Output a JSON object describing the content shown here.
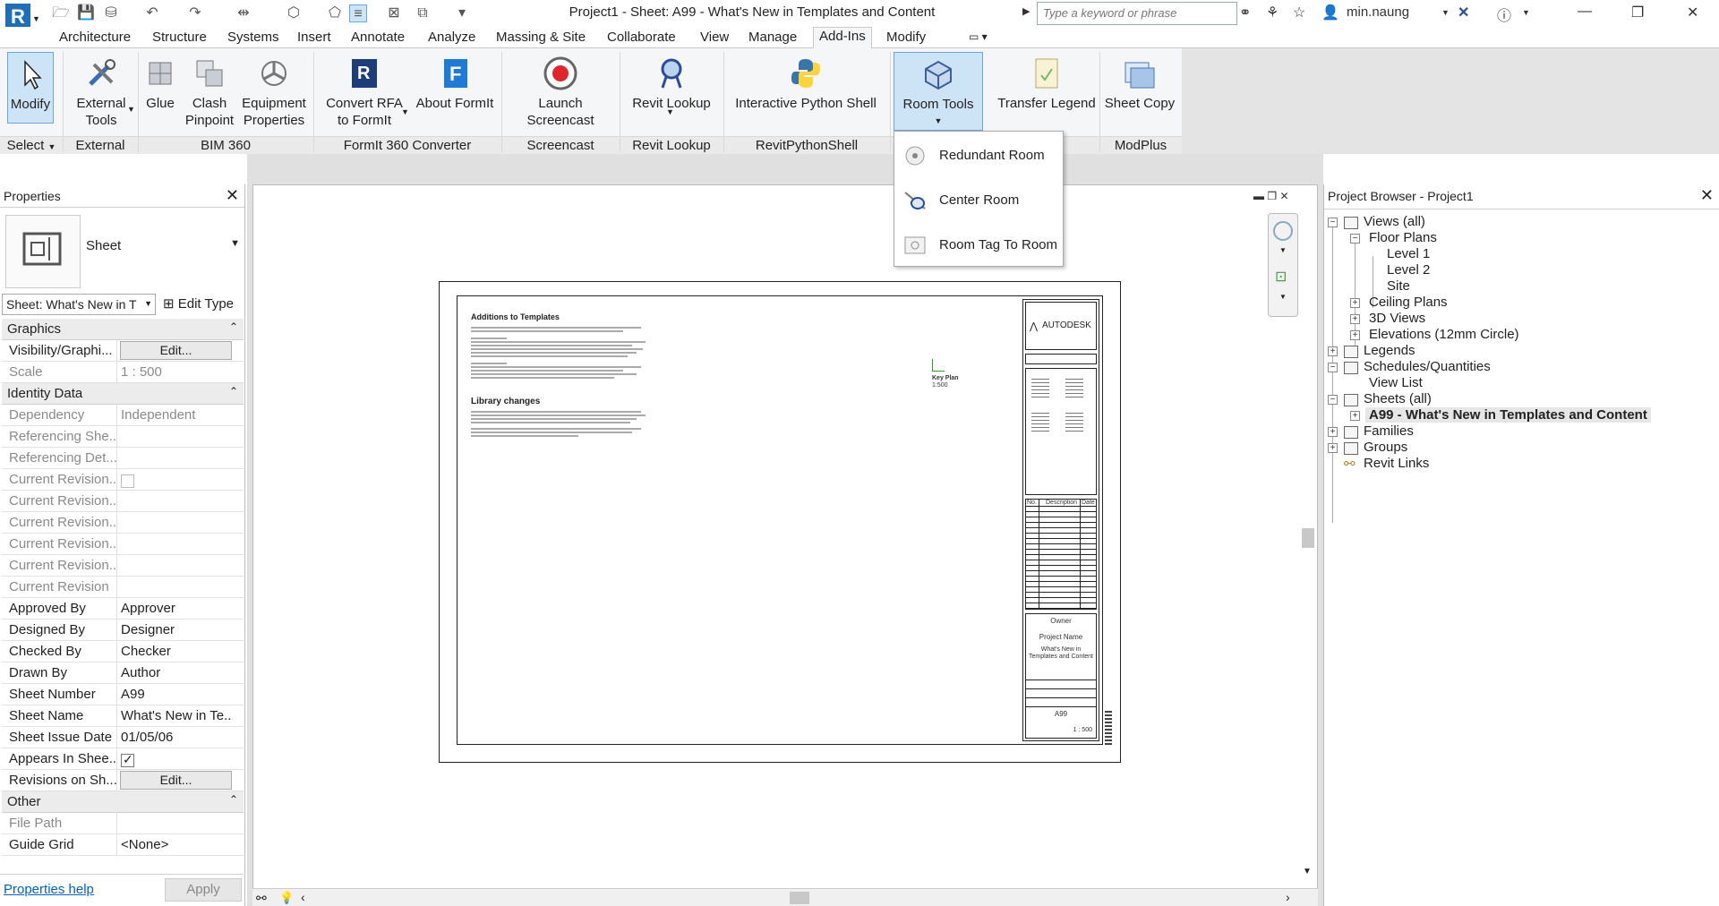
{
  "app": {
    "title": "Project1 - Sheet: A99 - What's New in Templates and Content",
    "search_placeholder": "Type a keyword or phrase",
    "user": "min.naung"
  },
  "tabs": [
    "Architecture",
    "Structure",
    "Systems",
    "Insert",
    "Annotate",
    "Analyze",
    "Massing & Site",
    "Collaborate",
    "View",
    "Manage",
    "Add-Ins",
    "Modify"
  ],
  "active_tab": "Add-Ins",
  "ribbon": {
    "buttons": {
      "modify": "Modify",
      "external_tools_1": "External",
      "external_tools_2": "Tools",
      "glue": "Glue",
      "clash_1": "Clash",
      "clash_2": "Pinpoint",
      "equip_1": "Equipment",
      "equip_2": "Properties",
      "convert_1": "Convert RFA",
      "convert_2": "to FormIt",
      "about_formit": "About FormIt",
      "screencast": "Launch Screencast",
      "revit_lookup": "Revit Lookup",
      "python_shell": "Interactive Python Shell",
      "room_tools": "Room Tools",
      "transfer_legend": "Transfer Legend",
      "sheet_copy": "Sheet Copy"
    },
    "groups": {
      "select": "Select",
      "external": "External",
      "bim360": "BIM 360",
      "formit": "FormIt 360 Converter",
      "screencast": "Screencast",
      "revit_lookup": "Revit Lookup",
      "python": "RevitPythonShell",
      "modplus": "ModPlus"
    }
  },
  "dropdown": {
    "items": [
      "Redundant Room",
      "Center Room",
      "Room Tag To Room"
    ]
  },
  "properties": {
    "title": "Properties",
    "type_name": "Sheet",
    "instance_selector": "Sheet: What's New in T",
    "edit_type": "Edit Type",
    "categories": {
      "graphics": "Graphics",
      "identity": "Identity Data",
      "other": "Other"
    },
    "graphics_rows": [
      {
        "k": "Visibility/Graphi...",
        "v": "Edit..."
      },
      {
        "k": "Scale",
        "v": "1 : 500"
      }
    ],
    "identity_rows": [
      {
        "k": "Dependency",
        "v": "Independent"
      },
      {
        "k": "Referencing She...",
        "v": ""
      },
      {
        "k": "Referencing Det...",
        "v": ""
      },
      {
        "k": "Current Revision...",
        "v": ""
      },
      {
        "k": "Current Revision...",
        "v": ""
      },
      {
        "k": "Current Revision...",
        "v": ""
      },
      {
        "k": "Current Revision...",
        "v": ""
      },
      {
        "k": "Current Revision...",
        "v": ""
      },
      {
        "k": "Current Revision",
        "v": ""
      },
      {
        "k": "Approved By",
        "v": "Approver"
      },
      {
        "k": "Designed By",
        "v": "Designer"
      },
      {
        "k": "Checked By",
        "v": "Checker"
      },
      {
        "k": "Drawn By",
        "v": "Author"
      },
      {
        "k": "Sheet Number",
        "v": "A99"
      },
      {
        "k": "Sheet Name",
        "v": "What's New in Te..."
      },
      {
        "k": "Sheet Issue Date",
        "v": "01/05/06"
      },
      {
        "k": "Appears In Shee...",
        "v": ""
      },
      {
        "k": "Revisions on Sh...",
        "v": "Edit..."
      }
    ],
    "other_rows": [
      {
        "k": "File Path",
        "v": ""
      },
      {
        "k": "Guide Grid",
        "v": "<None>"
      }
    ],
    "help": "Properties help",
    "apply": "Apply"
  },
  "sheet": {
    "heading1": "Additions to Templates",
    "heading2": "Library changes",
    "key_plan": "Key Plan",
    "key_scale": "1:500",
    "logo": "AUTODESK",
    "owner": "Owner",
    "project_name": "Project Name",
    "sheet_title": "What's New in Templates and Content",
    "sheet_no": "A99",
    "scale_val": "1 : 500",
    "rev_cols": [
      "No.",
      "Description",
      "Date"
    ]
  },
  "browser": {
    "title": "Project Browser - Project1",
    "nodes": {
      "views": "Views (all)",
      "floor_plans": "Floor Plans",
      "level1": "Level 1",
      "level2": "Level 2",
      "site": "Site",
      "ceiling": "Ceiling Plans",
      "views3d": "3D Views",
      "elevations": "Elevations (12mm Circle)",
      "legends": "Legends",
      "schedules": "Schedules/Quantities",
      "view_list": "View List",
      "sheets": "Sheets (all)",
      "a99": "A99 - What's New in Templates and Content",
      "families": "Families",
      "groups": "Groups",
      "revit_links": "Revit Links"
    }
  }
}
